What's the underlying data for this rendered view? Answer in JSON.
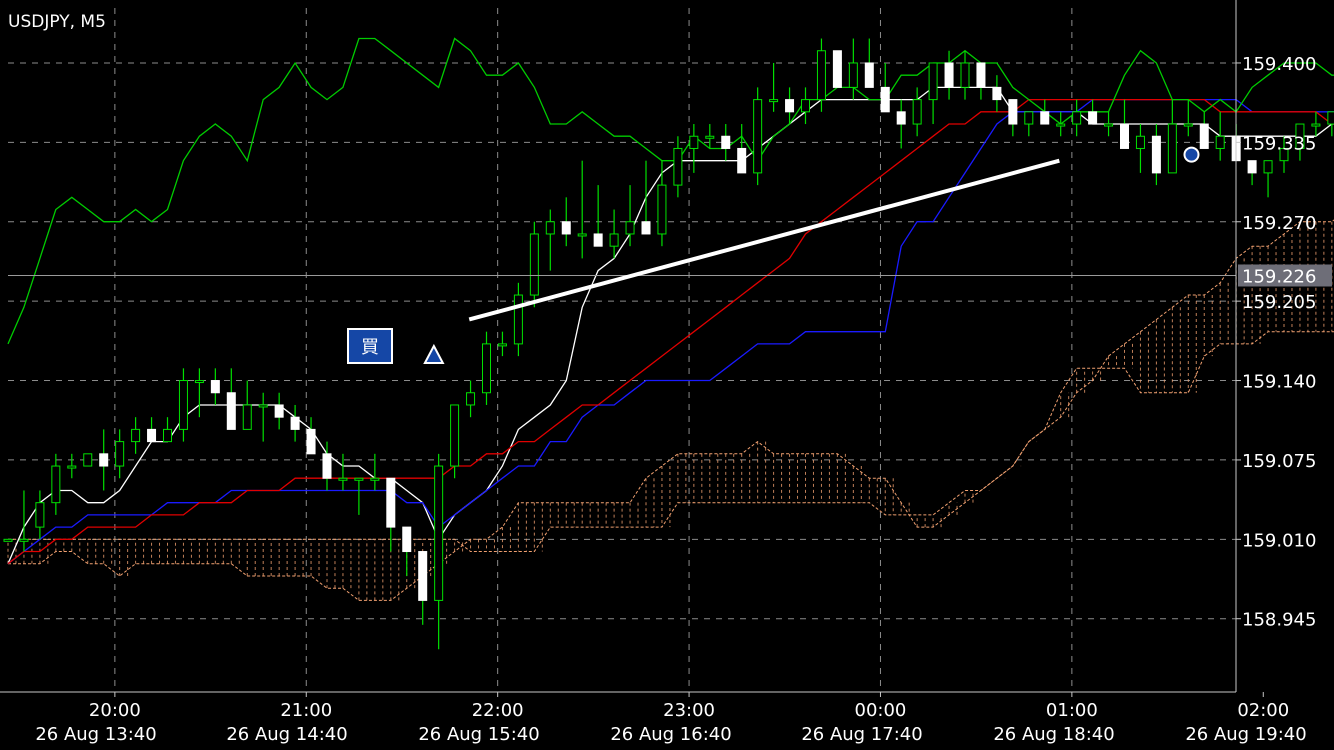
{
  "chart_title": "USDJPY, M5",
  "chart_data": {
    "type": "candlestick",
    "symbol": "USDJPY",
    "timeframe": "M5",
    "ylim": [
      158.885,
      159.445
    ],
    "price_ticks": [
      "159.400",
      "159.335",
      "159.270",
      "159.205",
      "159.140",
      "159.075",
      "159.010",
      "158.945"
    ],
    "current_price": "159.226",
    "time_ticks_top": [
      "20:00",
      "21:00",
      "22:00",
      "23:00",
      "00:00",
      "01:00",
      "02:00"
    ],
    "time_ticks_bottom": [
      "26 Aug 13:40",
      "26 Aug 14:40",
      "26 Aug 15:40",
      "26 Aug 16:40",
      "26 Aug 17:40",
      "26 Aug 18:40",
      "26 Aug 19:40"
    ],
    "candles": [
      [
        159.01,
        159.0,
        159.0,
        159.01
      ],
      [
        159.01,
        159.05,
        159.0,
        159.01
      ],
      [
        159.02,
        159.05,
        159.01,
        159.04
      ],
      [
        159.04,
        159.08,
        159.03,
        159.07
      ],
      [
        159.07,
        159.08,
        159.06,
        159.07
      ],
      [
        159.07,
        159.08,
        159.07,
        159.08
      ],
      [
        159.08,
        159.1,
        159.05,
        159.07
      ],
      [
        159.07,
        159.1,
        159.06,
        159.09
      ],
      [
        159.09,
        159.11,
        159.08,
        159.1
      ],
      [
        159.1,
        159.11,
        159.09,
        159.09
      ],
      [
        159.09,
        159.11,
        159.09,
        159.1
      ],
      [
        159.1,
        159.15,
        159.09,
        159.14
      ],
      [
        159.14,
        159.15,
        159.11,
        159.14
      ],
      [
        159.14,
        159.15,
        159.12,
        159.13
      ],
      [
        159.13,
        159.15,
        159.1,
        159.1
      ],
      [
        159.1,
        159.14,
        159.1,
        159.12
      ],
      [
        159.12,
        159.13,
        159.09,
        159.12
      ],
      [
        159.12,
        159.13,
        159.1,
        159.11
      ],
      [
        159.11,
        159.12,
        159.09,
        159.1
      ],
      [
        159.1,
        159.11,
        159.08,
        159.08
      ],
      [
        159.08,
        159.09,
        159.05,
        159.06
      ],
      [
        159.06,
        159.08,
        159.05,
        159.06
      ],
      [
        159.06,
        159.06,
        159.03,
        159.06
      ],
      [
        159.06,
        159.08,
        159.05,
        159.06
      ],
      [
        159.06,
        159.06,
        159.0,
        159.02
      ],
      [
        159.02,
        159.02,
        158.98,
        159.0
      ],
      [
        159.0,
        159.0,
        158.94,
        158.96
      ],
      [
        158.96,
        159.08,
        158.92,
        159.07
      ],
      [
        159.07,
        159.12,
        159.06,
        159.12
      ],
      [
        159.12,
        159.14,
        159.11,
        159.13
      ],
      [
        159.13,
        159.18,
        159.12,
        159.17
      ],
      [
        159.17,
        159.18,
        159.16,
        159.17
      ],
      [
        159.17,
        159.22,
        159.16,
        159.21
      ],
      [
        159.21,
        159.27,
        159.2,
        159.26
      ],
      [
        159.26,
        159.28,
        159.23,
        159.27
      ],
      [
        159.27,
        159.29,
        159.25,
        159.26
      ],
      [
        159.26,
        159.32,
        159.24,
        159.26
      ],
      [
        159.26,
        159.3,
        159.25,
        159.25
      ],
      [
        159.25,
        159.28,
        159.24,
        159.26
      ],
      [
        159.26,
        159.3,
        159.25,
        159.27
      ],
      [
        159.27,
        159.32,
        159.26,
        159.26
      ],
      [
        159.26,
        159.32,
        159.25,
        159.3
      ],
      [
        159.3,
        159.34,
        159.29,
        159.33
      ],
      [
        159.33,
        159.35,
        159.31,
        159.34
      ],
      [
        159.34,
        159.35,
        159.33,
        159.34
      ],
      [
        159.34,
        159.35,
        159.32,
        159.33
      ],
      [
        159.33,
        159.35,
        159.31,
        159.31
      ],
      [
        159.31,
        159.38,
        159.3,
        159.37
      ],
      [
        159.37,
        159.4,
        159.36,
        159.37
      ],
      [
        159.37,
        159.38,
        159.35,
        159.36
      ],
      [
        159.36,
        159.38,
        159.35,
        159.37
      ],
      [
        159.37,
        159.42,
        159.36,
        159.41
      ],
      [
        159.41,
        159.41,
        159.38,
        159.38
      ],
      [
        159.38,
        159.42,
        159.37,
        159.4
      ],
      [
        159.4,
        159.42,
        159.39,
        159.38
      ],
      [
        159.38,
        159.4,
        159.36,
        159.36
      ],
      [
        159.36,
        159.37,
        159.33,
        159.35
      ],
      [
        159.35,
        159.38,
        159.34,
        159.37
      ],
      [
        159.37,
        159.4,
        159.35,
        159.4
      ],
      [
        159.4,
        159.41,
        159.37,
        159.38
      ],
      [
        159.38,
        159.41,
        159.37,
        159.4
      ],
      [
        159.4,
        159.4,
        159.37,
        159.38
      ],
      [
        159.38,
        159.39,
        159.36,
        159.37
      ],
      [
        159.37,
        159.37,
        159.34,
        159.35
      ],
      [
        159.35,
        159.36,
        159.34,
        159.36
      ],
      [
        159.36,
        159.37,
        159.35,
        159.35
      ],
      [
        159.35,
        159.36,
        159.34,
        159.35
      ],
      [
        159.35,
        159.37,
        159.34,
        159.36
      ],
      [
        159.36,
        159.37,
        159.35,
        159.35
      ],
      [
        159.35,
        159.36,
        159.34,
        159.35
      ],
      [
        159.35,
        159.37,
        159.34,
        159.33
      ],
      [
        159.33,
        159.35,
        159.31,
        159.34
      ],
      [
        159.34,
        159.35,
        159.3,
        159.31
      ],
      [
        159.31,
        159.37,
        159.31,
        159.35
      ],
      [
        159.35,
        159.37,
        159.34,
        159.35
      ],
      [
        159.35,
        159.36,
        159.33,
        159.33
      ],
      [
        159.33,
        159.36,
        159.32,
        159.34
      ],
      [
        159.34,
        159.35,
        159.32,
        159.32
      ],
      [
        159.32,
        159.32,
        159.3,
        159.31
      ],
      [
        159.31,
        159.32,
        159.29,
        159.32
      ],
      [
        159.32,
        159.34,
        159.31,
        159.33
      ],
      [
        159.33,
        159.35,
        159.32,
        159.35
      ],
      [
        159.35,
        159.36,
        159.34,
        159.35
      ],
      [
        159.35,
        159.36,
        159.34,
        159.36
      ],
      [
        159.36,
        159.37,
        159.35,
        159.36
      ],
      [
        159.36,
        159.37,
        159.35,
        159.36
      ],
      [
        159.36,
        159.41,
        159.35,
        159.39
      ]
    ],
    "series": [
      {
        "color": "#ffffff",
        "values": [
          158.99,
          159.02,
          159.04,
          159.05,
          159.05,
          159.04,
          159.04,
          159.05,
          159.07,
          159.09,
          159.09,
          159.11,
          159.12,
          159.12,
          159.12,
          159.12,
          159.12,
          159.12,
          159.11,
          159.1,
          159.08,
          159.07,
          159.07,
          159.06,
          159.06,
          159.05,
          159.04,
          159.01,
          159.03,
          159.04,
          159.05,
          159.07,
          159.1,
          159.11,
          159.12,
          159.14,
          159.2,
          159.23,
          159.24,
          159.26,
          159.29,
          159.31,
          159.32,
          159.32,
          159.32,
          159.32,
          159.32,
          159.33,
          159.34,
          159.35,
          159.36,
          159.37,
          159.37,
          159.37,
          159.37,
          159.37,
          159.37,
          159.37,
          159.38,
          159.38,
          159.38,
          159.38,
          159.38,
          159.36,
          159.36,
          159.36,
          159.36,
          159.36,
          159.35,
          159.35,
          159.35,
          159.35,
          159.35,
          159.35,
          159.35,
          159.35,
          159.34,
          159.34,
          159.34,
          159.34,
          159.34,
          159.34,
          159.34,
          159.35,
          159.35,
          159.35
        ]
      },
      {
        "color": "#1a1aff",
        "values": [
          158.99,
          159.0,
          159.01,
          159.02,
          159.02,
          159.03,
          159.03,
          159.03,
          159.03,
          159.03,
          159.04,
          159.04,
          159.04,
          159.04,
          159.05,
          159.05,
          159.05,
          159.05,
          159.05,
          159.05,
          159.05,
          159.05,
          159.05,
          159.05,
          159.05,
          159.04,
          159.04,
          159.02,
          159.03,
          159.04,
          159.05,
          159.06,
          159.07,
          159.07,
          159.09,
          159.09,
          159.11,
          159.12,
          159.12,
          159.13,
          159.14,
          159.14,
          159.14,
          159.14,
          159.14,
          159.15,
          159.16,
          159.17,
          159.17,
          159.17,
          159.18,
          159.18,
          159.18,
          159.18,
          159.18,
          159.18,
          159.25,
          159.27,
          159.27,
          159.29,
          159.31,
          159.33,
          159.35,
          159.36,
          159.36,
          159.36,
          159.36,
          159.36,
          159.37,
          159.37,
          159.37,
          159.37,
          159.37,
          159.37,
          159.37,
          159.37,
          159.37,
          159.37,
          159.36,
          159.36,
          159.36,
          159.36,
          159.36,
          159.36,
          159.36,
          159.36
        ]
      },
      {
        "color": "#e00000",
        "values": [
          158.99,
          159.0,
          159.0,
          159.01,
          159.01,
          159.02,
          159.02,
          159.02,
          159.02,
          159.03,
          159.03,
          159.03,
          159.04,
          159.04,
          159.04,
          159.05,
          159.05,
          159.05,
          159.06,
          159.06,
          159.06,
          159.06,
          159.06,
          159.06,
          159.06,
          159.06,
          159.06,
          159.06,
          159.07,
          159.07,
          159.08,
          159.08,
          159.09,
          159.09,
          159.1,
          159.11,
          159.12,
          159.12,
          159.13,
          159.14,
          159.15,
          159.16,
          159.17,
          159.18,
          159.19,
          159.2,
          159.21,
          159.22,
          159.23,
          159.24,
          159.26,
          159.27,
          159.28,
          159.29,
          159.3,
          159.31,
          159.32,
          159.33,
          159.34,
          159.35,
          159.35,
          159.36,
          159.36,
          159.36,
          159.37,
          159.37,
          159.37,
          159.37,
          159.37,
          159.37,
          159.37,
          159.37,
          159.37,
          159.37,
          159.37,
          159.37,
          159.36,
          159.36,
          159.36,
          159.36,
          159.36,
          159.36,
          159.36,
          159.35,
          159.35,
          159.35
        ]
      },
      {
        "color": "#00cc00",
        "values": [
          159.17,
          159.2,
          159.24,
          159.28,
          159.29,
          159.28,
          159.27,
          159.27,
          159.28,
          159.27,
          159.28,
          159.32,
          159.34,
          159.35,
          159.34,
          159.32,
          159.37,
          159.38,
          159.4,
          159.38,
          159.37,
          159.38,
          159.42,
          159.42,
          159.41,
          159.4,
          159.39,
          159.38,
          159.42,
          159.41,
          159.39,
          159.39,
          159.4,
          159.38,
          159.35,
          159.35,
          159.36,
          159.35,
          159.34,
          159.34,
          159.33,
          159.32,
          159.32,
          159.34,
          159.33,
          159.33,
          159.34,
          159.32,
          159.34,
          159.35,
          159.37,
          159.37,
          159.38,
          159.38,
          159.37,
          159.37,
          159.39,
          159.39,
          159.4,
          159.4,
          159.41,
          159.4,
          159.4,
          159.38,
          159.37,
          159.36,
          159.35,
          159.36,
          159.36,
          159.36,
          159.39,
          159.41,
          159.4,
          159.37,
          159.37,
          159.36,
          159.37,
          159.36,
          159.38,
          159.39,
          159.4,
          159.4,
          159.4,
          159.39,
          159.39,
          159.36
        ]
      }
    ],
    "cloud": {
      "color": "#f0a070",
      "spanA": [
        158.99,
        158.99,
        158.99,
        159.0,
        159.0,
        158.99,
        158.99,
        158.98,
        158.99,
        158.99,
        158.99,
        158.99,
        158.99,
        158.99,
        158.99,
        158.98,
        158.98,
        158.98,
        158.98,
        158.98,
        158.97,
        158.97,
        158.96,
        158.96,
        158.96,
        158.97,
        158.98,
        158.99,
        159.0,
        159.01,
        159.01,
        159.02,
        159.04,
        159.04,
        159.04,
        159.04,
        159.04,
        159.04,
        159.04,
        159.04,
        159.06,
        159.07,
        159.08,
        159.08,
        159.08,
        159.08,
        159.08,
        159.09,
        159.08,
        159.08,
        159.08,
        159.08,
        159.08,
        159.07,
        159.06,
        159.06,
        159.04,
        159.02,
        159.02,
        159.03,
        159.04,
        159.05,
        159.06,
        159.07,
        159.09,
        159.1,
        159.11,
        159.13,
        159.14,
        159.16,
        159.17,
        159.18,
        159.19,
        159.2,
        159.21,
        159.21,
        159.22,
        159.24,
        159.25,
        159.25,
        159.26,
        159.27,
        159.27,
        159.27,
        159.28,
        159.31
      ],
      "spanB": [
        159.01,
        159.01,
        159.01,
        159.01,
        159.01,
        159.01,
        159.01,
        159.01,
        159.01,
        159.01,
        159.01,
        159.01,
        159.01,
        159.01,
        159.01,
        159.01,
        159.01,
        159.01,
        159.01,
        159.01,
        159.01,
        159.01,
        159.01,
        159.01,
        159.01,
        159.01,
        159.01,
        159.01,
        159.01,
        159.0,
        159.0,
        159.0,
        159.0,
        159.0,
        159.02,
        159.02,
        159.02,
        159.02,
        159.02,
        159.02,
        159.02,
        159.02,
        159.04,
        159.04,
        159.04,
        159.04,
        159.04,
        159.04,
        159.04,
        159.04,
        159.04,
        159.04,
        159.04,
        159.04,
        159.04,
        159.03,
        159.03,
        159.03,
        159.03,
        159.04,
        159.05,
        159.05,
        159.06,
        159.07,
        159.09,
        159.1,
        159.13,
        159.15,
        159.15,
        159.15,
        159.15,
        159.13,
        159.13,
        159.13,
        159.13,
        159.16,
        159.17,
        159.17,
        159.17,
        159.18,
        159.18,
        159.18,
        159.18,
        159.18,
        159.18,
        159.18
      ]
    },
    "buy_label": "買",
    "trendline": {
      "from": [
        15.75,
        159.19
      ],
      "to": [
        73.0,
        159.32
      ]
    },
    "marker_candle_index": 26.7,
    "exit_marker_index": 74.2,
    "exit_marker_price": 159.325
  }
}
